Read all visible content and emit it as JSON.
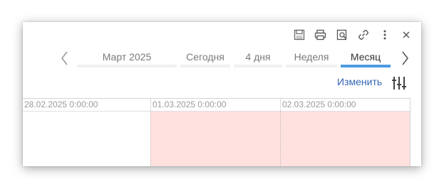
{
  "toolbar": {
    "buttons": [
      {
        "name": "save-icon"
      },
      {
        "name": "print-icon"
      },
      {
        "name": "print-preview-icon"
      },
      {
        "name": "link-icon"
      },
      {
        "name": "more-vertical-icon"
      },
      {
        "name": "close-icon"
      }
    ]
  },
  "period_nav": {
    "tabs": [
      {
        "label": "Март 2025",
        "active": false
      },
      {
        "label": "Сегодня",
        "active": false
      },
      {
        "label": "4 дня",
        "active": false
      },
      {
        "label": "Неделя",
        "active": false
      },
      {
        "label": "Месяц",
        "active": true
      }
    ]
  },
  "actions": {
    "edit_label": "Изменить",
    "settings_icon": "sliders-icon"
  },
  "timeline": {
    "columns": [
      {
        "label": "28.02.2025 0:00:00"
      },
      {
        "label": "01.03.2025 0:00:00"
      },
      {
        "label": "02.03.2025 0:00:00"
      }
    ],
    "highlight_color": "#ffe1e0"
  },
  "colors": {
    "accent": "#4a9be0",
    "link": "#3465b5"
  }
}
